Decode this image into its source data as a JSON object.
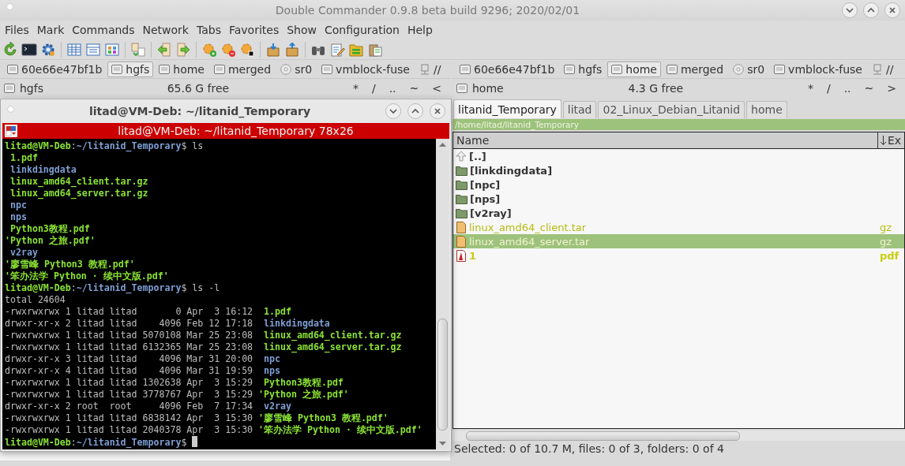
{
  "window": {
    "title": "Double Commander 0.9.8 beta build 9296; 2020/02/01"
  },
  "menu": [
    "Files",
    "Mark",
    "Commands",
    "Network",
    "Tabs",
    "Favorites",
    "Show",
    "Configuration",
    "Help"
  ],
  "toolbar": [
    {
      "kind": "refresh"
    },
    {
      "kind": "terminal"
    },
    {
      "kind": "gear"
    },
    {
      "kind": "separator"
    },
    {
      "kind": "table"
    },
    {
      "kind": "list"
    },
    {
      "kind": "grid"
    },
    {
      "kind": "separator"
    },
    {
      "kind": "swap"
    },
    {
      "kind": "separator"
    },
    {
      "kind": "copy_left"
    },
    {
      "kind": "copy_right"
    },
    {
      "kind": "separator"
    },
    {
      "kind": "fav_add"
    },
    {
      "kind": "fav_remove"
    },
    {
      "kind": "fav_edit"
    },
    {
      "kind": "separator"
    },
    {
      "kind": "pack"
    },
    {
      "kind": "unpack"
    },
    {
      "kind": "separator"
    },
    {
      "kind": "search"
    },
    {
      "kind": "edit"
    },
    {
      "kind": "folders"
    },
    {
      "kind": "clipboard"
    }
  ],
  "left_panel": {
    "drives": [
      {
        "label": "60e66e47bf1b",
        "kind": "disk",
        "selected": false
      },
      {
        "label": "hgfs",
        "kind": "disk",
        "selected": true
      },
      {
        "label": "home",
        "kind": "disk",
        "selected": false
      },
      {
        "label": "merged",
        "kind": "disk",
        "selected": false
      },
      {
        "label": "sr0",
        "kind": "cdrom",
        "selected": false
      },
      {
        "label": "vmblock-fuse",
        "kind": "disk",
        "selected": false
      },
      {
        "label": "//",
        "kind": "network",
        "selected": false
      }
    ],
    "drive": "hgfs",
    "free": "65.6 G free",
    "nav": [
      "*",
      "/",
      "..",
      "~",
      "<"
    ]
  },
  "right_panel": {
    "drives": [
      {
        "label": "60e66e47bf1b",
        "kind": "disk",
        "selected": false
      },
      {
        "label": "hgfs",
        "kind": "disk",
        "selected": false
      },
      {
        "label": "home",
        "kind": "disk",
        "selected": true
      },
      {
        "label": "merged",
        "kind": "disk",
        "selected": false
      },
      {
        "label": "sr0",
        "kind": "cdrom",
        "selected": false
      },
      {
        "label": "vmblock-fuse",
        "kind": "disk",
        "selected": false
      },
      {
        "label": "//",
        "kind": "network",
        "selected": false
      }
    ],
    "drive": "home",
    "free": "4.3 G free",
    "nav": [
      "*",
      "/",
      "..",
      "~",
      ">"
    ],
    "tabs": [
      {
        "label": "litanid_Temporary",
        "selected": true
      },
      {
        "label": "litad",
        "selected": false
      },
      {
        "label": "02_Linux_Debian_Litanid",
        "selected": false
      },
      {
        "label": "home",
        "selected": false
      }
    ],
    "path": "/home/litad/litanid_Temporary",
    "columns": [
      "Name",
      "Ex"
    ],
    "files": [
      {
        "name": "[..]",
        "kind": "up",
        "selected": false
      },
      {
        "name": "[linkdingdata]",
        "kind": "folder",
        "selected": false
      },
      {
        "name": "[npc]",
        "kind": "folder",
        "selected": false
      },
      {
        "name": "[nps]",
        "kind": "folder",
        "selected": false
      },
      {
        "name": "[v2ray]",
        "kind": "folder",
        "selected": false
      },
      {
        "name": "linux_amd64_client.tar",
        "ext": "gz",
        "kind": "archive",
        "selected": false
      },
      {
        "name": "linux_amd64_server.tar",
        "ext": "gz",
        "kind": "archive",
        "selected": true
      },
      {
        "name": "1",
        "ext": "pdf",
        "kind": "pdf",
        "selected": false
      }
    ],
    "status": "Selected: 0 of 10.7 M, files: 0 of 3, folders: 0 of 4"
  },
  "terminal": {
    "title": "litad@VM-Deb: ~/litanid_Temporary",
    "header": "litad@VM-Deb: ~/litanid_Temporary 78x26",
    "cursor": true,
    "lines": [
      [
        {
          "text": "litad@VM-Deb",
          "kind": "user"
        },
        {
          "text": ":",
          "kind": "plain"
        },
        {
          "text": "~/litanid_Temporary",
          "kind": "path"
        },
        {
          "text": "$ ls",
          "kind": "plain"
        }
      ],
      [
        {
          "text": " 1.pdf",
          "kind": "exec"
        }
      ],
      [
        {
          "text": " linkdingdata",
          "kind": "dir"
        }
      ],
      [
        {
          "text": " linux_amd64_client.tar.gz",
          "kind": "exec"
        }
      ],
      [
        {
          "text": " linux_amd64_server.tar.gz",
          "kind": "exec"
        }
      ],
      [
        {
          "text": " npc",
          "kind": "dir"
        }
      ],
      [
        {
          "text": " nps",
          "kind": "dir"
        }
      ],
      [
        {
          "text": " Python3教程.pdf",
          "kind": "exec"
        }
      ],
      [
        {
          "text": "'Python 之旅.pdf'",
          "kind": "exec"
        }
      ],
      [
        {
          "text": " v2ray",
          "kind": "dir"
        }
      ],
      [
        {
          "text": "'廖雪峰 Python3 教程.pdf'",
          "kind": "exec"
        }
      ],
      [
        {
          "text": "'笨办法学 Python · 续中文版.pdf'",
          "kind": "exec"
        }
      ],
      [
        {
          "text": "litad@VM-Deb",
          "kind": "user"
        },
        {
          "text": ":",
          "kind": "plain"
        },
        {
          "text": "~/litanid_Temporary",
          "kind": "path"
        },
        {
          "text": "$ ls -l",
          "kind": "plain"
        }
      ],
      [
        {
          "text": "total 24604",
          "kind": "plain"
        }
      ],
      [
        {
          "text": "-rwxrwxrwx 1 litad litad       0 Apr  3 16:12 ",
          "kind": "plain"
        },
        {
          "text": " 1.pdf",
          "kind": "exec"
        }
      ],
      [
        {
          "text": "drwxr-xr-x 2 litad litad    4096 Feb 12 17:18 ",
          "kind": "plain"
        },
        {
          "text": " linkdingdata",
          "kind": "dir"
        }
      ],
      [
        {
          "text": "-rwxrwxrwx 1 litad litad 5070108 Mar 25 23:08 ",
          "kind": "plain"
        },
        {
          "text": " linux_amd64_client.tar.gz",
          "kind": "exec"
        }
      ],
      [
        {
          "text": "-rwxrwxrwx 1 litad litad 6132365 Mar 25 23:08 ",
          "kind": "plain"
        },
        {
          "text": " linux_amd64_server.tar.gz",
          "kind": "exec"
        }
      ],
      [
        {
          "text": "drwxr-xr-x 3 litad litad    4096 Mar 31 20:00 ",
          "kind": "plain"
        },
        {
          "text": " npc",
          "kind": "dir"
        }
      ],
      [
        {
          "text": "drwxr-xr-x 4 litad litad    4096 Mar 31 19:59 ",
          "kind": "plain"
        },
        {
          "text": " nps",
          "kind": "dir"
        }
      ],
      [
        {
          "text": "-rwxrwxrwx 1 litad litad 1302638 Apr  3 15:29 ",
          "kind": "plain"
        },
        {
          "text": " Python3教程.pdf",
          "kind": "exec"
        }
      ],
      [
        {
          "text": "-rwxrwxrwx 1 litad litad 3778767 Apr  3 15:29 ",
          "kind": "plain"
        },
        {
          "text": "'Python 之旅.pdf'",
          "kind": "exec"
        }
      ],
      [
        {
          "text": "drwxr-xr-x 2 root  root     4096 Feb  7 17:34 ",
          "kind": "plain"
        },
        {
          "text": " v2ray",
          "kind": "dir"
        }
      ],
      [
        {
          "text": "-rwxrwxrwx 1 litad litad 6838142 Apr  3 15:30 ",
          "kind": "plain"
        },
        {
          "text": "'廖雪峰 Python3 教程.pdf'",
          "kind": "exec"
        }
      ],
      [
        {
          "text": "-rwxrwxrwx 1 litad litad 2040378 Apr  3 15:30 ",
          "kind": "plain"
        },
        {
          "text": "'笨办法学 Python · 续中文版.pdf'",
          "kind": "exec"
        }
      ],
      [
        {
          "text": "litad@VM-Deb",
          "kind": "user"
        },
        {
          "text": ":",
          "kind": "plain"
        },
        {
          "text": "~/litanid_Temporary",
          "kind": "path"
        },
        {
          "text": "$",
          "kind": "plain"
        }
      ]
    ]
  }
}
